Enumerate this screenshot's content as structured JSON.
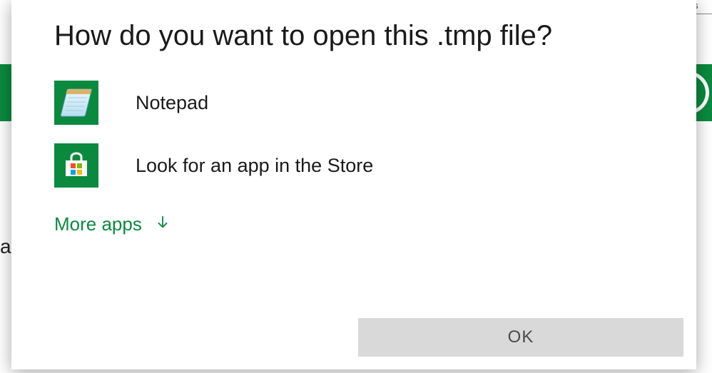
{
  "background": {
    "edge_text_left": "a",
    "edge_text_top": "s"
  },
  "dialog": {
    "title": "How do you want to open this .tmp file?",
    "apps": [
      {
        "label": "Notepad",
        "icon": "notepad"
      },
      {
        "label": "Look for an app in the Store",
        "icon": "store"
      }
    ],
    "more_apps_label": "More apps",
    "ok_label": "OK"
  },
  "colors": {
    "accent": "#0b8a3f"
  }
}
